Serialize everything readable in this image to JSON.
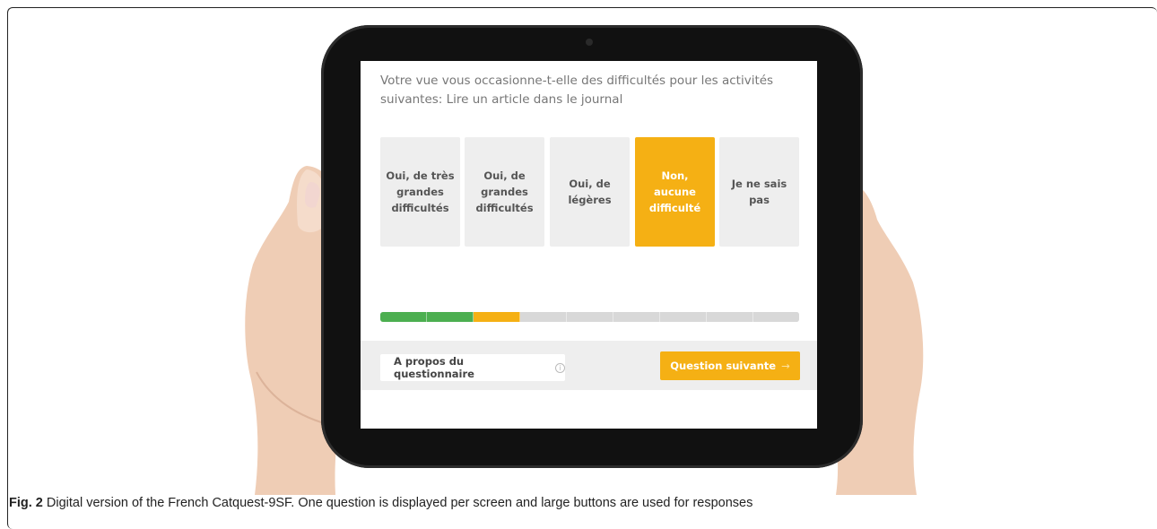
{
  "question": {
    "text": "Votre vue vous occasionne-t-elle des difficultés pour les activités suivantes: Lire un article dans le journal"
  },
  "options": [
    {
      "label": "Oui, de très grandes difficultés",
      "selected": false
    },
    {
      "label": "Oui, de grandes difficultés",
      "selected": false
    },
    {
      "label": "Oui, de légères",
      "selected": false
    },
    {
      "label": "Non, aucune difficulté",
      "selected": true
    },
    {
      "label": "Je ne sais pas",
      "selected": false
    }
  ],
  "progress": {
    "segments": 9,
    "completed": 2,
    "current": 1
  },
  "footer": {
    "about_label": "A propos du questionnaire",
    "next_label": "Question suivante"
  },
  "icons": {
    "info": "info-circle-icon",
    "next": "arrow-right-icon"
  },
  "colors": {
    "accent": "#f5b014",
    "done": "#4caf50",
    "pending": "#d8d8d8"
  },
  "caption": {
    "label": "Fig. 2",
    "text": " Digital version of the French Catquest-9SF. One question is displayed per screen and large buttons are used for responses"
  }
}
